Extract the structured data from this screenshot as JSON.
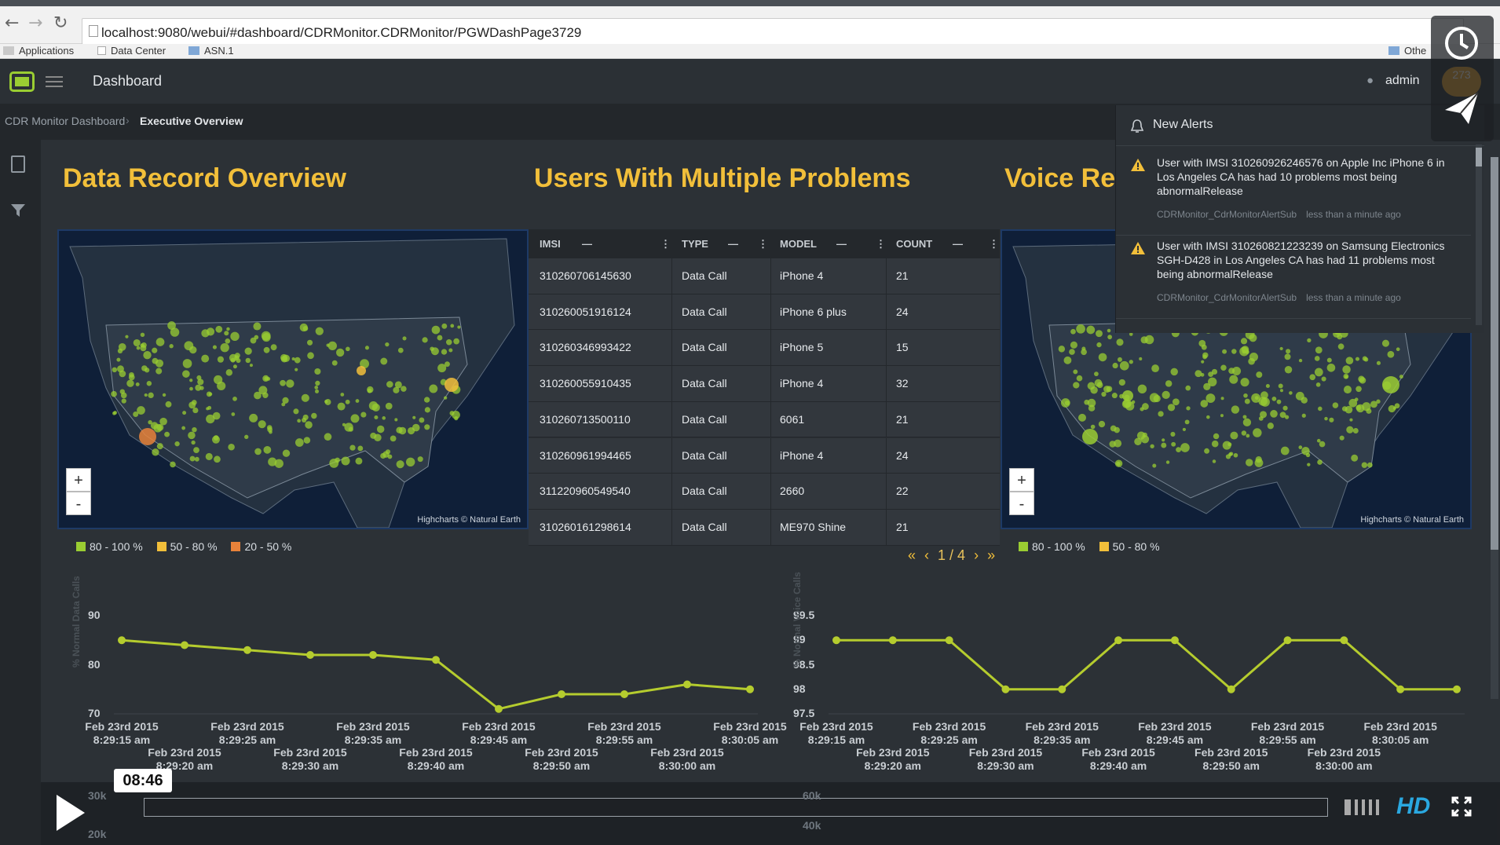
{
  "browser": {
    "url": "localhost:9080/webui/#dashboard/CDRMonitor.CDRMonitor/PGWDashPage3729",
    "bookmarks": [
      "Applications",
      "Data Center",
      "ASN.1"
    ],
    "other_bookmarks": "Othe"
  },
  "header": {
    "title": "Dashboard",
    "user": "admin",
    "badge": "273"
  },
  "breadcrumb": {
    "items": [
      "CDR Monitor Dashboard",
      "Executive Overview"
    ]
  },
  "sections": {
    "left_title": "Data Record Overview",
    "mid_title": "Users With Multiple Problems",
    "right_title": "Voice Re"
  },
  "map": {
    "zoom_in": "+",
    "zoom_out": "-",
    "credit": "Highcharts © Natural Earth"
  },
  "legend_left": [
    "80 - 100 %",
    "50 - 80 %",
    "20 - 50 %"
  ],
  "legend_right": [
    "80 - 100 %",
    "50 - 80 %"
  ],
  "legend_colors": {
    "high": "#9acd32",
    "mid": "#f2bf3a",
    "low": "#e8823a"
  },
  "table": {
    "headers": [
      "IMSI",
      "TYPE",
      "MODEL",
      "COUNT"
    ],
    "rows": [
      [
        "310260706145630",
        "Data Call",
        "iPhone 4",
        "21"
      ],
      [
        "310260051916124",
        "Data Call",
        "iPhone 6 plus",
        "24"
      ],
      [
        "310260346993422",
        "Data Call",
        "iPhone 5",
        "15"
      ],
      [
        "310260055910435",
        "Data Call",
        "iPhone 4",
        "32"
      ],
      [
        "310260713500110",
        "Data Call",
        "6061",
        "21"
      ],
      [
        "310260961994465",
        "Data Call",
        "iPhone 4",
        "24"
      ],
      [
        "311220960549540",
        "Data Call",
        "2660",
        "22"
      ],
      [
        "310260161298614",
        "Data Call",
        "ME970 Shine",
        "21"
      ]
    ],
    "pager": {
      "first": "«",
      "prev": "‹",
      "text": "1 / 4",
      "next": "›",
      "last": "»"
    }
  },
  "alerts": {
    "title": "New Alerts",
    "items": [
      {
        "message": "User with IMSI 310260926246576 on Apple Inc iPhone 6 in Los Angeles CA has had 10 problems most being abnormalRelease",
        "source": "CDRMonitor_CdrMonitorAlertSub",
        "time": "less than a minute ago"
      },
      {
        "message": "User with IMSI 310260821223239 on Samsung Electronics SGH-D428 in Los Angeles CA has had 11 problems most being abnormalRelease",
        "source": "CDRMonitor_CdrMonitorAlertSub",
        "time": "less than a minute ago"
      }
    ]
  },
  "chart_data": [
    {
      "type": "line",
      "ylabel": "% Normal Data Calls",
      "ylim": [
        70,
        90
      ],
      "yticks": [
        "90",
        "80",
        "70"
      ],
      "x": [
        "Feb 23rd 2015 8:29:15 am",
        "Feb 23rd 2015 8:29:20 am",
        "Feb 23rd 2015 8:29:25 am",
        "Feb 23rd 2015 8:29:30 am",
        "Feb 23rd 2015 8:29:35 am",
        "Feb 23rd 2015 8:29:40 am",
        "Feb 23rd 2015 8:29:45 am",
        "Feb 23rd 2015 8:29:50 am",
        "Feb 23rd 2015 8:29:55 am",
        "Feb 23rd 2015 8:30:00 am",
        "Feb 23rd 2015 8:30:05 am"
      ],
      "xlabels_top": [
        [
          "Feb 23rd 2015",
          "8:29:15 am"
        ],
        [
          "Feb 23rd 2015",
          "8:29:25 am"
        ],
        [
          "Feb 23rd 2015",
          "8:29:35 am"
        ],
        [
          "Feb 23rd 2015",
          "8:29:45 am"
        ],
        [
          "Feb 23rd 2015",
          "8:29:55 am"
        ],
        [
          "Feb 23rd 2015",
          "8:30:05 am"
        ]
      ],
      "xlabels_bottom": [
        [
          "Feb 23rd 2015",
          "8:29:20 am"
        ],
        [
          "Feb 23rd 2015",
          "8:29:30 am"
        ],
        [
          "Feb 23rd 2015",
          "8:29:40 am"
        ],
        [
          "Feb 23rd 2015",
          "8:29:50 am"
        ],
        [
          "Feb 23rd 2015",
          "8:30:00 am"
        ]
      ],
      "series": [
        {
          "values": [
            85,
            84,
            83,
            82,
            82,
            81,
            71,
            74,
            74,
            76,
            75
          ]
        }
      ]
    },
    {
      "type": "line",
      "ylabel": "% Normal Voice Calls",
      "ylim": [
        97.5,
        99.5
      ],
      "yticks": [
        "99.5",
        "99",
        "98.5",
        "98",
        "97.5"
      ],
      "x": [
        "Feb 23rd 2015 8:29:15 am",
        "Feb 23rd 2015 8:29:20 am",
        "Feb 23rd 2015 8:29:25 am",
        "Feb 23rd 2015 8:29:30 am",
        "Feb 23rd 2015 8:29:35 am",
        "Feb 23rd 2015 8:29:40 am",
        "Feb 23rd 2015 8:29:45 am",
        "Feb 23rd 2015 8:29:50 am",
        "Feb 23rd 2015 8:29:55 am",
        "Feb 23rd 2015 8:30:00 am",
        "Feb 23rd 2015 8:30:05 am"
      ],
      "xlabels_top": [
        [
          "Feb 23rd 2015",
          "8:29:15 am"
        ],
        [
          "Feb 23rd 2015",
          "8:29:25 am"
        ],
        [
          "Feb 23rd 2015",
          "8:29:35 am"
        ],
        [
          "Feb 23rd 2015",
          "8:29:45 am"
        ],
        [
          "Feb 23rd 2015",
          "8:29:55 am"
        ],
        [
          "Feb 23rd 2015",
          "8:30:05 am"
        ]
      ],
      "xlabels_bottom": [
        [
          "Feb 23rd 2015",
          "8:29:20 am"
        ],
        [
          "Feb 23rd 2015",
          "8:29:30 am"
        ],
        [
          "Feb 23rd 2015",
          "8:29:40 am"
        ],
        [
          "Feb 23rd 2015",
          "8:29:50 am"
        ],
        [
          "Feb 23rd 2015",
          "8:30:00 am"
        ]
      ],
      "series": [
        {
          "values": [
            99,
            99,
            99,
            98,
            98,
            99,
            99,
            98,
            99,
            99,
            98,
            98
          ]
        }
      ]
    }
  ],
  "bottom_axis_left": [
    "30k",
    "20k"
  ],
  "bottom_axis_right": [
    "60k",
    "40k"
  ],
  "video": {
    "time": "08:46",
    "hd": "HD"
  }
}
